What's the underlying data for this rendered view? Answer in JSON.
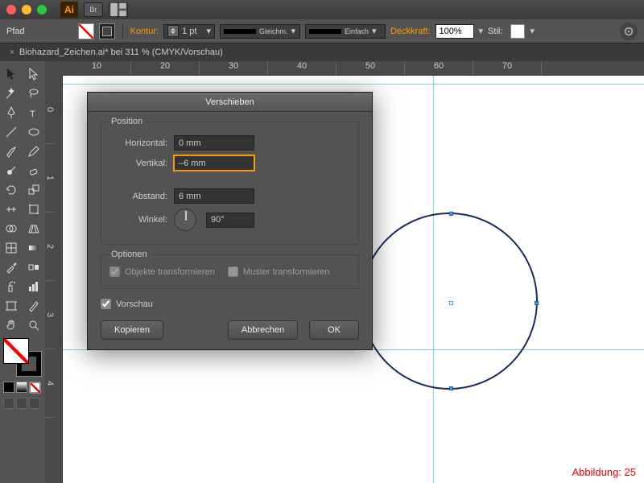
{
  "titlebar": {
    "logo": "Ai",
    "br": "Br"
  },
  "control": {
    "path_label": "Pfad",
    "contour_label": "Kontur:",
    "stroke_weight": "1 pt",
    "cap_text": "Gleichm.",
    "join_text": "Einfach",
    "opacity_label": "Deckkraft:",
    "opacity_value": "100%",
    "style_label": "Stil:"
  },
  "doc": {
    "title": "Biohazard_Zeichen.ai* bei 311 % (CMYK/Vorschau)",
    "close": "×"
  },
  "ruler_h": [
    "10",
    "20",
    "30",
    "40",
    "50",
    "60",
    "70"
  ],
  "ruler_v": [
    "0",
    "1",
    "2",
    "3",
    "4"
  ],
  "dialog": {
    "title": "Verschieben",
    "position_legend": "Position",
    "horizontal_label": "Horizontal:",
    "horizontal_value": "0 mm",
    "vertical_label": "Vertikal:",
    "vertical_value": "–6 mm",
    "distance_label": "Abstand:",
    "distance_value": "6 mm",
    "angle_label": "Winkel:",
    "angle_value": "90°",
    "options_legend": "Optionen",
    "transform_objects": "Objekte transformieren",
    "transform_patterns": "Muster transformieren",
    "preview": "Vorschau",
    "copy": "Kopieren",
    "cancel": "Abbrechen",
    "ok": "OK"
  },
  "caption": "Abbildung: 25"
}
